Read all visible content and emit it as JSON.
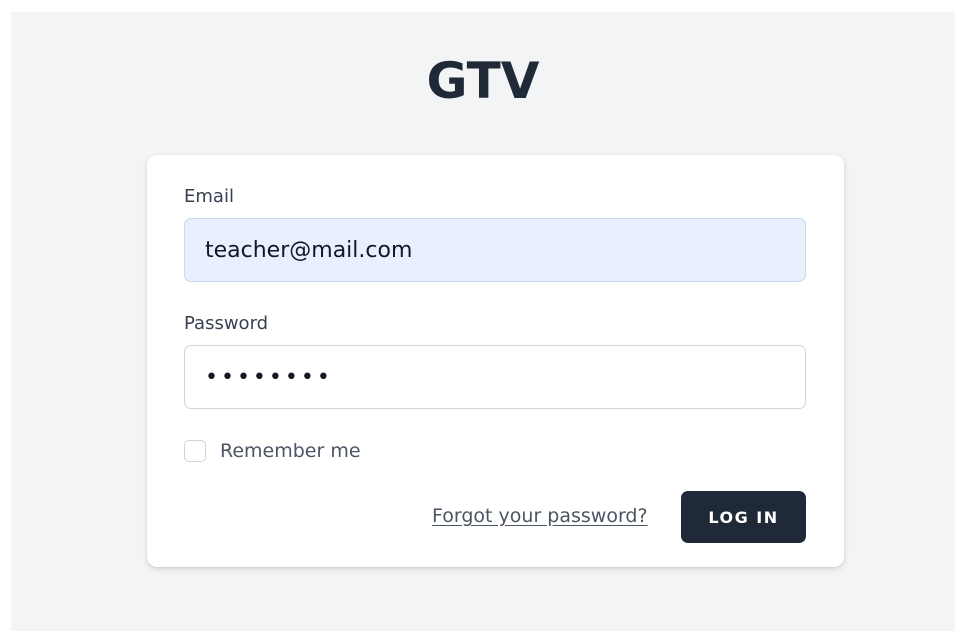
{
  "app": {
    "logo_text": "GTV"
  },
  "form": {
    "email_label": "Email",
    "email_value": "teacher@mail.com",
    "password_label": "Password",
    "password_value": "••••••••",
    "remember_label": "Remember me",
    "remember_checked": false,
    "forgot_link": "Forgot your password?",
    "login_button": "LOG IN"
  },
  "colors": {
    "page_background": "#f3f4f6",
    "card_background": "#ffffff",
    "autofill_background": "#e8f0fe",
    "button_background": "#1f2937",
    "button_text": "#ffffff"
  }
}
